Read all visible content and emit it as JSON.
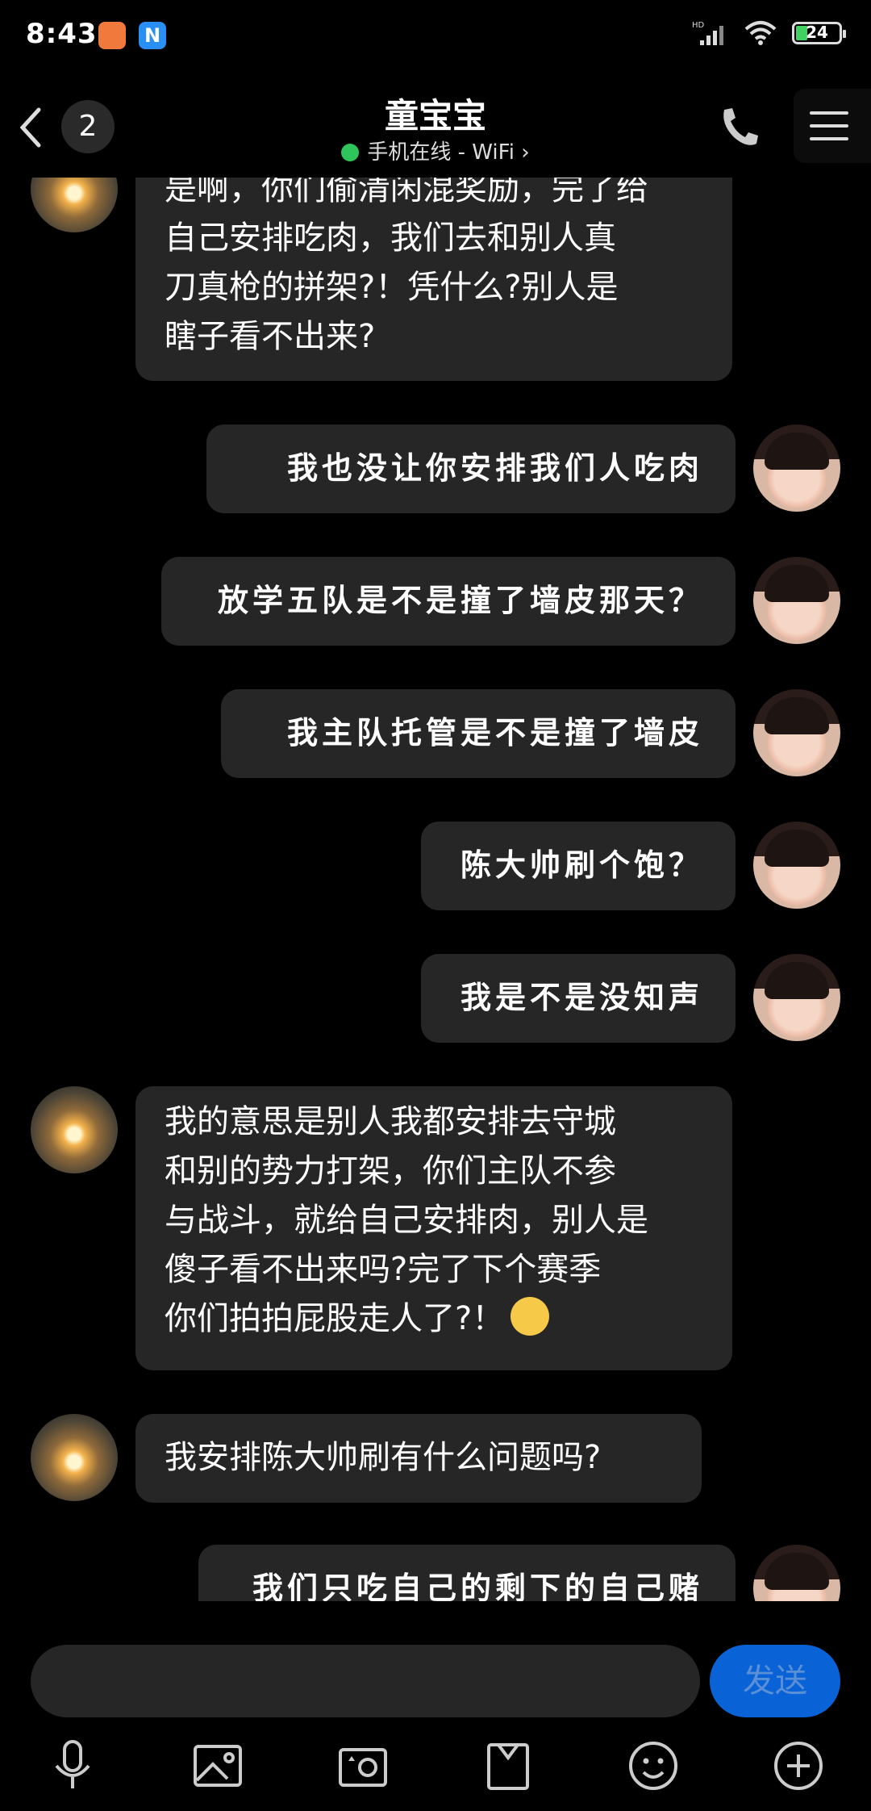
{
  "status": {
    "time": "8:43",
    "network": "HD",
    "battery": "24"
  },
  "header": {
    "unread_count": "2",
    "title": "童宝宝",
    "presence": "手机在线 - WiFi",
    "presence_color": "#2ec55a"
  },
  "messages": [
    {
      "side": "left",
      "lines": [
        "是啊，你们偷清闲混奖励，完了给",
        "自己安排吃肉，我们去和别人真",
        "刀真枪的拼架?！凭什么?别人是",
        "瞎子看不出来?"
      ]
    },
    {
      "side": "right",
      "lines": [
        "我也没让你安排我们人吃肉"
      ]
    },
    {
      "side": "right",
      "lines": [
        "放学五队是不是撞了墙皮那天？"
      ]
    },
    {
      "side": "right",
      "lines": [
        "我主队托管是不是撞了墙皮"
      ]
    },
    {
      "side": "right",
      "lines": [
        "陈大帅刷个饱？"
      ]
    },
    {
      "side": "right",
      "lines": [
        "我是不是没知声"
      ]
    },
    {
      "side": "left",
      "lines": [
        "我的意思是别人我都安排去守城",
        "和别的势力打架，你们主队不参",
        "与战斗，就给自己安排肉，别人是",
        "傻子看不出来吗?完了下个赛季",
        "你们拍拍屁股走人了?！"
      ],
      "trailing_emoji": "hug-emoji"
    },
    {
      "side": "left",
      "lines": [
        "我安排陈大帅刷有什么问题吗?"
      ]
    },
    {
      "side": "right",
      "lines": [
        "我们只吃自己的剩下的自己赌"
      ]
    }
  ],
  "composer": {
    "value": "",
    "send_label": "发送",
    "accent": "#0a63d6"
  },
  "toolbar": [
    "microphone-icon",
    "image-icon",
    "camera-icon",
    "file-icon",
    "emoji-icon",
    "plus-icon"
  ]
}
